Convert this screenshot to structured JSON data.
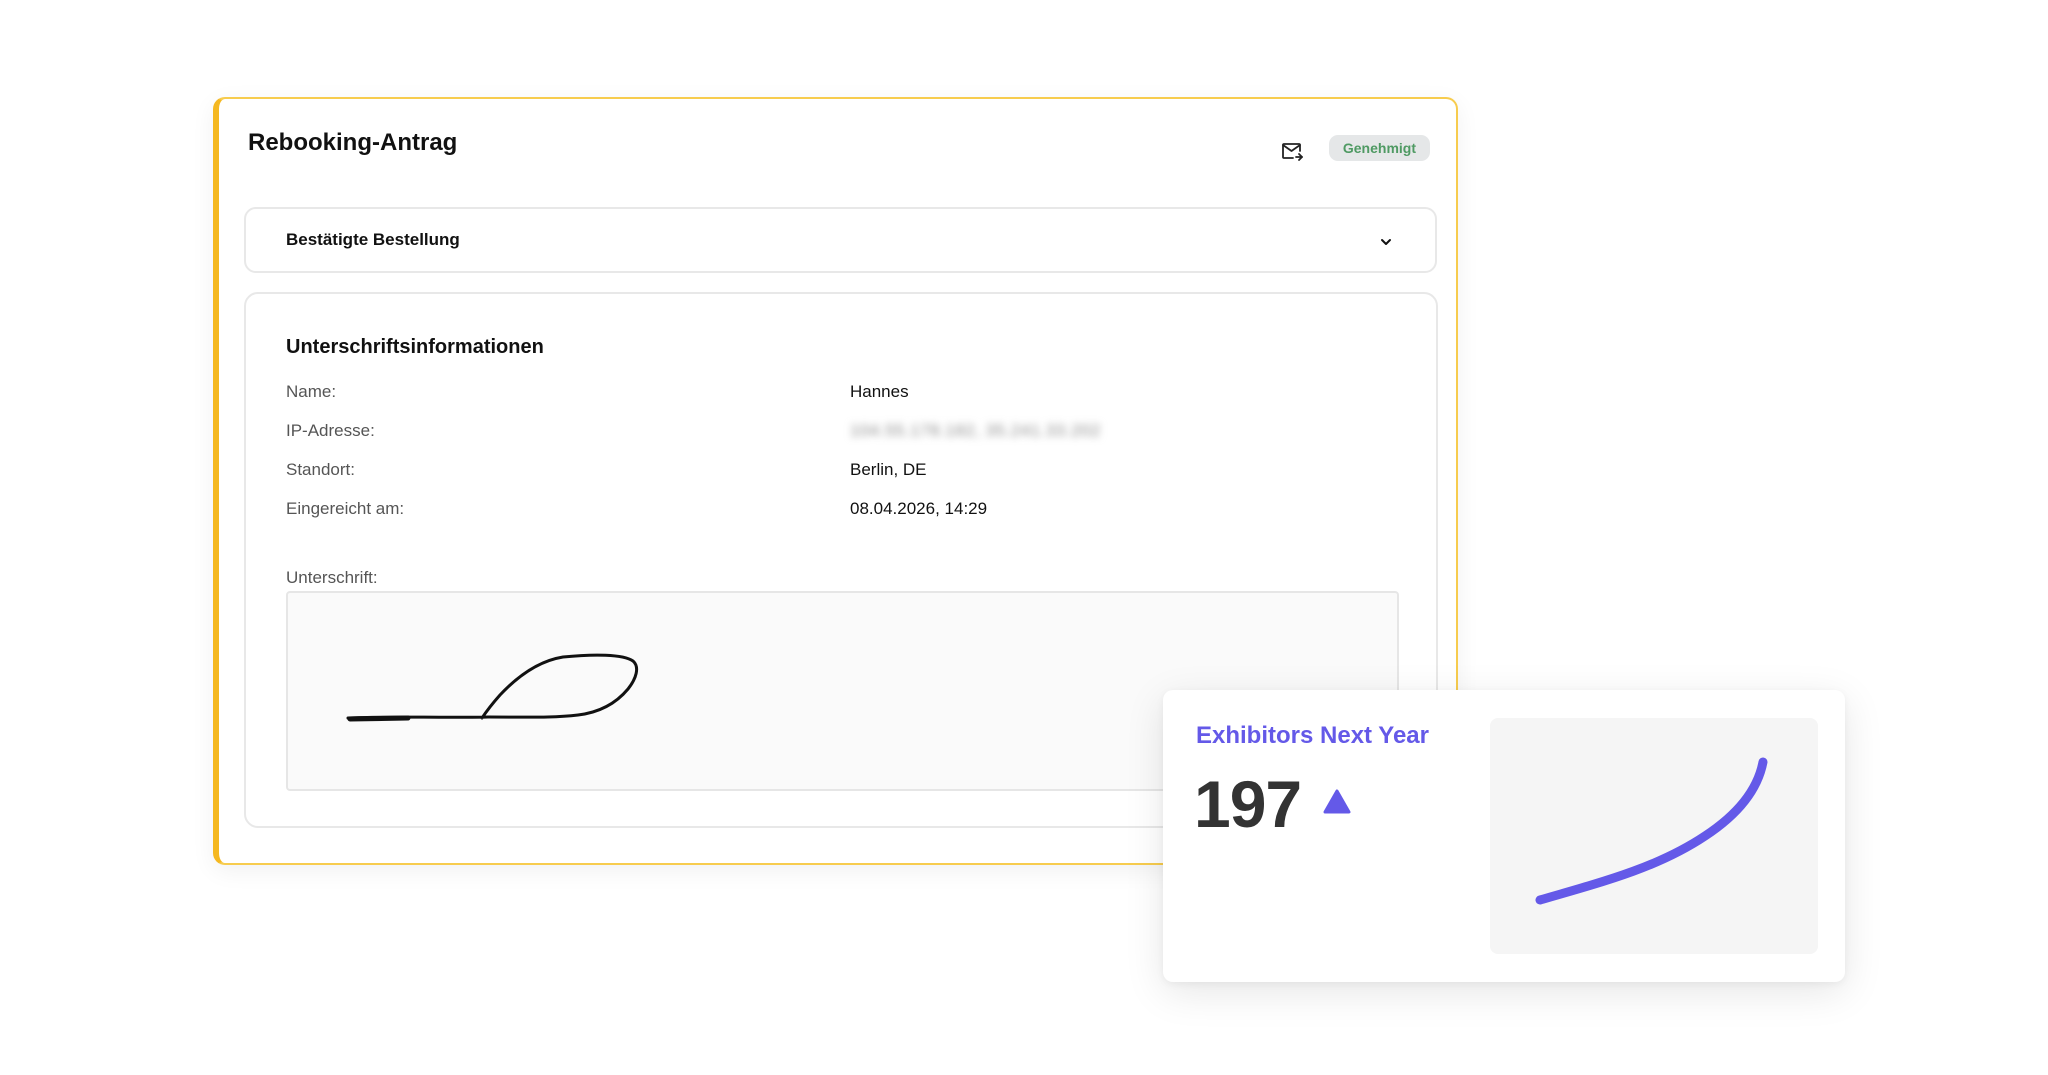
{
  "rebooking": {
    "title": "Rebooking-Antrag",
    "status_badge": "Genehmigt",
    "icons": {
      "mail": "mail-send-icon"
    },
    "accordion": {
      "label": "Bestätigte Bestellung",
      "icon": "chevron-down-icon"
    },
    "signature_info": {
      "heading": "Unterschriftsinformationen",
      "fields": [
        {
          "label": "Name:",
          "value": "Hannes"
        },
        {
          "label": "IP-Adresse:",
          "value": "104.55.178.182, 35.241.33.202"
        },
        {
          "label": "Standort:",
          "value": "Berlin, DE"
        },
        {
          "label": "Eingereicht am:",
          "value": "08.04.2026, 14:29"
        }
      ],
      "signature_label": "Unterschrift:"
    }
  },
  "stat_card": {
    "title": "Exhibitors Next Year",
    "value": "197",
    "trend": "up",
    "icons": {
      "trend": "trend-up-icon"
    }
  },
  "colors": {
    "card_border": "#f5b820",
    "accent": "#6459e8",
    "badge_text": "#4f9a63",
    "badge_bg": "#e5e7e8"
  }
}
